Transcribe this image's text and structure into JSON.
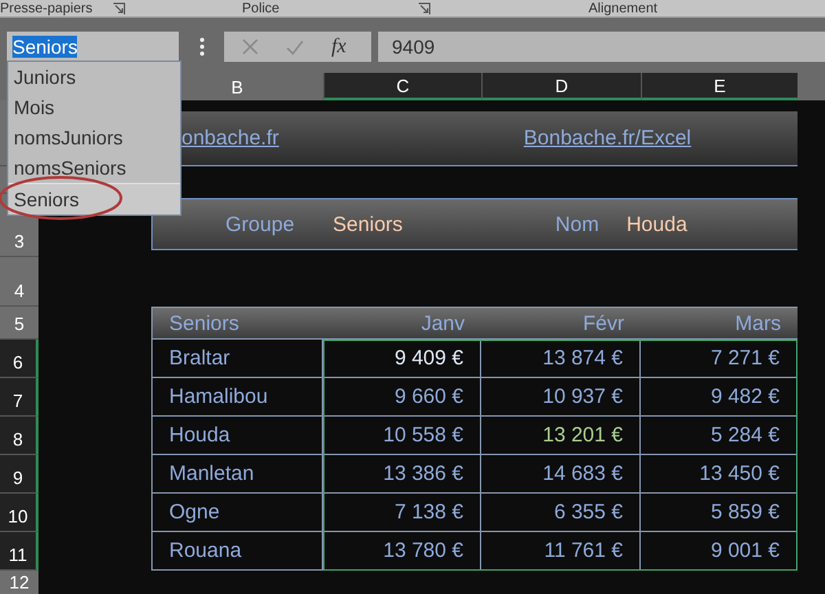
{
  "ribbon_groups": [
    {
      "label": "Presse-papiers",
      "launcher": true
    },
    {
      "label": "Police",
      "launcher": true
    },
    {
      "label": "Alignement",
      "launcher": false
    }
  ],
  "name_box": {
    "value": "Seniors",
    "text_selected": true
  },
  "name_list": [
    {
      "label": "Juniors",
      "selected": false
    },
    {
      "label": "Mois",
      "selected": false
    },
    {
      "label": "nomsJuniors",
      "selected": false
    },
    {
      "label": "nomsSeniors",
      "selected": false
    },
    {
      "label": "Seniors",
      "selected": true
    }
  ],
  "formula_bar": {
    "function_label": "fx",
    "value": "9409"
  },
  "column_headers": [
    {
      "label": "B",
      "selected": false
    },
    {
      "label": "C",
      "selected": true
    },
    {
      "label": "D",
      "selected": true
    },
    {
      "label": "E",
      "selected": true
    }
  ],
  "row_headers": [
    {
      "label": "3",
      "selected": false
    },
    {
      "label": "4",
      "selected": false
    },
    {
      "label": "5",
      "selected": false
    },
    {
      "label": "6",
      "selected": true
    },
    {
      "label": "7",
      "selected": true
    },
    {
      "label": "8",
      "selected": true
    },
    {
      "label": "9",
      "selected": true
    },
    {
      "label": "10",
      "selected": true
    },
    {
      "label": "11",
      "selected": true
    },
    {
      "label": "12",
      "selected": false
    }
  ],
  "banner": {
    "links": [
      "onbache.fr",
      "Bonbache.fr/Excel"
    ]
  },
  "filter_panel": {
    "group_label": "Groupe",
    "group_value": "Seniors",
    "name_label": "Nom",
    "name_value": "Houda"
  },
  "table": {
    "columns": [
      "Seniors",
      "Janv",
      "Févr",
      "Mars"
    ],
    "rows": [
      {
        "name": "Braltar",
        "values": [
          {
            "text": "9 409 €",
            "active": true,
            "highlight": false
          },
          {
            "text": "13 874 €",
            "active": false,
            "highlight": false
          },
          {
            "text": "7 271 €",
            "active": false,
            "highlight": false
          }
        ]
      },
      {
        "name": "Hamalibou",
        "values": [
          {
            "text": "9 660 €",
            "active": false,
            "highlight": false
          },
          {
            "text": "10 937 €",
            "active": false,
            "highlight": false
          },
          {
            "text": "9 482 €",
            "active": false,
            "highlight": false
          }
        ]
      },
      {
        "name": "Houda",
        "values": [
          {
            "text": "10 558 €",
            "active": false,
            "highlight": false
          },
          {
            "text": "13 201 €",
            "active": false,
            "highlight": true
          },
          {
            "text": "5 284 €",
            "active": false,
            "highlight": false
          }
        ]
      },
      {
        "name": "Manletan",
        "values": [
          {
            "text": "13 386 €",
            "active": false,
            "highlight": false
          },
          {
            "text": "14 683 €",
            "active": false,
            "highlight": false
          },
          {
            "text": "13 450 €",
            "active": false,
            "highlight": false
          }
        ]
      },
      {
        "name": "Ogne",
        "values": [
          {
            "text": "7 138 €",
            "active": false,
            "highlight": false
          },
          {
            "text": "6 355 €",
            "active": false,
            "highlight": false
          },
          {
            "text": "5 859 €",
            "active": false,
            "highlight": false
          }
        ]
      },
      {
        "name": "Rouana",
        "values": [
          {
            "text": "13 780 €",
            "active": false,
            "highlight": false
          },
          {
            "text": "11 761 €",
            "active": false,
            "highlight": false
          },
          {
            "text": "9 001 €",
            "active": false,
            "highlight": false
          }
        ]
      }
    ]
  }
}
